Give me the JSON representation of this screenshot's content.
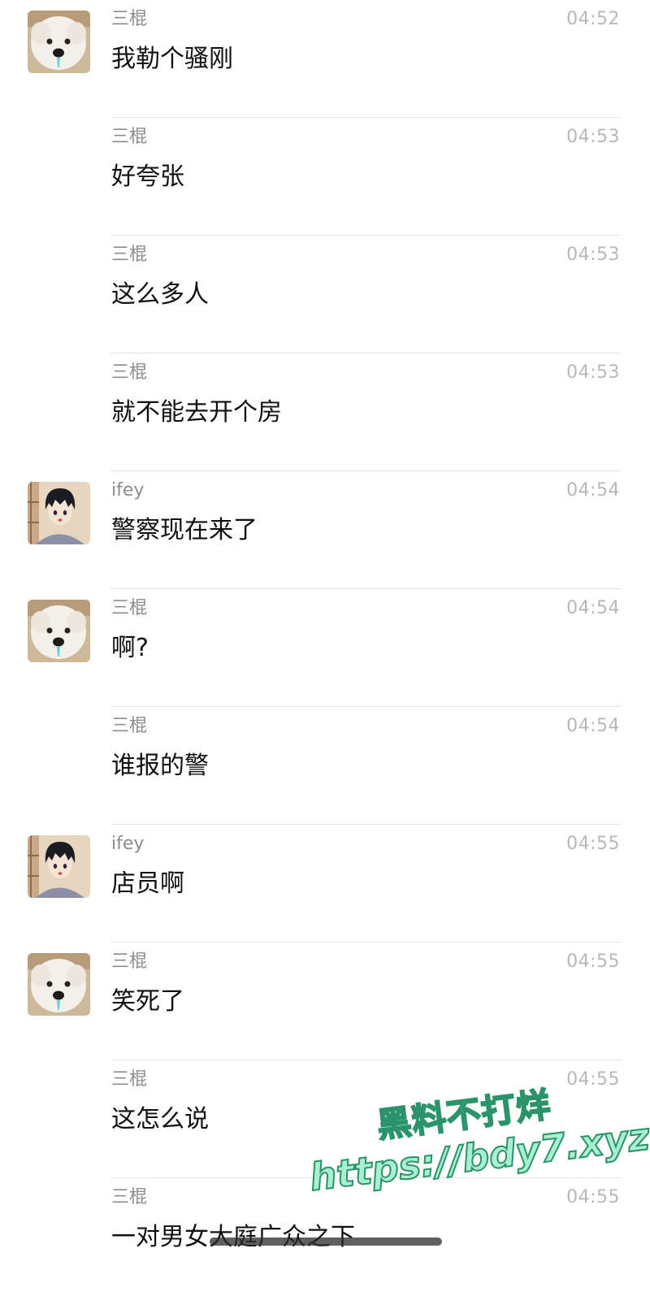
{
  "messages": [
    {
      "sender": "三棍",
      "time": "04:52",
      "text": "我勒个骚刚",
      "avatar": "dog"
    },
    {
      "sender": "三棍",
      "time": "04:53",
      "text": "好夸张",
      "avatar": null
    },
    {
      "sender": "三棍",
      "time": "04:53",
      "text": "这么多人",
      "avatar": null
    },
    {
      "sender": "三棍",
      "time": "04:53",
      "text": "就不能去开个房",
      "avatar": null
    },
    {
      "sender": "ifey",
      "time": "04:54",
      "text": "警察现在来了",
      "avatar": "anime-boy"
    },
    {
      "sender": "三棍",
      "time": "04:54",
      "text": "啊?",
      "avatar": "dog"
    },
    {
      "sender": "三棍",
      "time": "04:54",
      "text": "谁报的警",
      "avatar": null
    },
    {
      "sender": "ifey",
      "time": "04:55",
      "text": "店员啊",
      "avatar": "anime-boy"
    },
    {
      "sender": "三棍",
      "time": "04:55",
      "text": "笑死了",
      "avatar": "dog"
    },
    {
      "sender": "三棍",
      "time": "04:55",
      "text": "这怎么说",
      "avatar": null
    },
    {
      "sender": "三棍",
      "time": "04:55",
      "text": "一对男女大庭广众之下",
      "avatar": null
    }
  ],
  "watermark": {
    "line1": "黑料不打烊",
    "line2": "https://bdy7.xyz"
  },
  "colors": {
    "sender": "#8c8c8c",
    "time": "#b8b8b8",
    "text": "#111111",
    "divider": "#e6e6e6",
    "watermark_fill": "#a8f0d0",
    "watermark_stroke": "#2a9468"
  }
}
